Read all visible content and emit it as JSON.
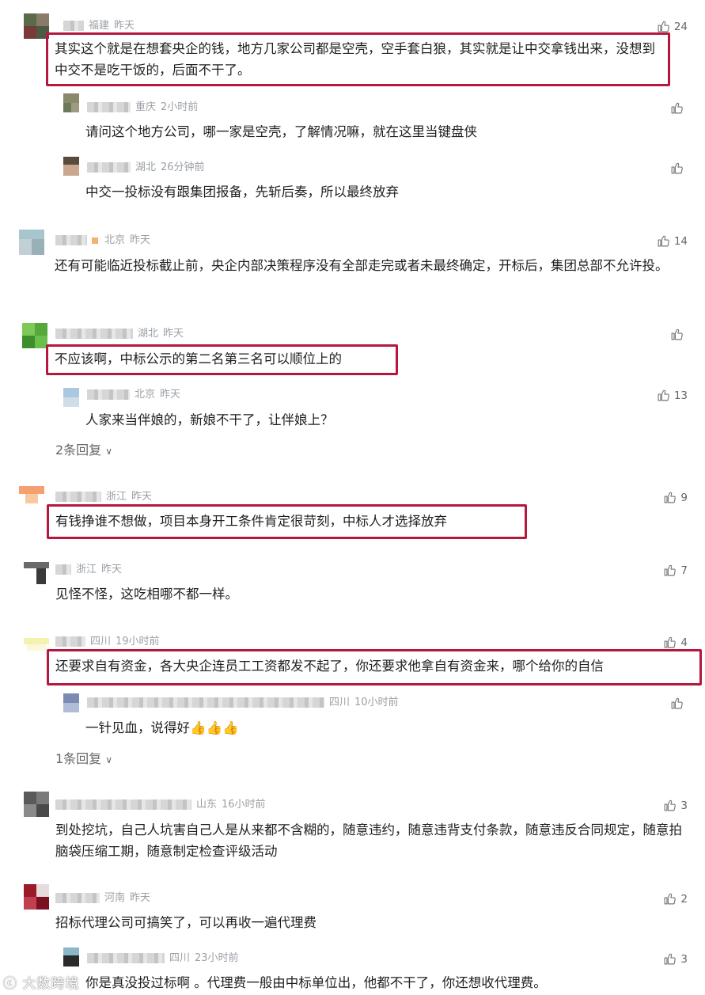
{
  "comments": [
    {
      "location": "福建",
      "time": "昨天",
      "likes": "24",
      "text": "其实这个就是在想套央企的钱，地方几家公司都是空壳，空手套白狼，其实就是让中交拿钱出来，没想到中交不是吃干饭的，后面不干了。"
    },
    {
      "location": "重庆",
      "time": "2小时前",
      "likes": "",
      "text": "请问这个地方公司，哪一家是空壳，了解情况嘛，就在这里当键盘侠"
    },
    {
      "location": "湖北",
      "time": "26分钟前",
      "likes": "",
      "text": "中交一投标没有跟集团报备，先斩后奏，所以最终放弃"
    },
    {
      "location": "北京",
      "time": "昨天",
      "likes": "14",
      "text": "还有可能临近投标截止前，央企内部决策程序没有全部走完或者未最终确定，开标后，集团总部不允许投。"
    },
    {
      "location": "湖北",
      "time": "昨天",
      "likes": "",
      "text": "不应该啊，中标公示的第二名第三名可以顺位上的"
    },
    {
      "location": "北京",
      "time": "昨天",
      "likes": "13",
      "text": "人家来当伴娘的，新娘不干了，让伴娘上？"
    },
    {
      "location": "浙江",
      "time": "昨天",
      "likes": "9",
      "text": "有钱挣谁不想做，项目本身开工条件肯定很苛刻，中标人才选择放弃"
    },
    {
      "location": "浙江",
      "time": "昨天",
      "likes": "7",
      "text": "见怪不怪，这吃相哪不都一样。"
    },
    {
      "location": "四川",
      "time": "19小时前",
      "likes": "4",
      "text": "还要求自有资金，各大央企连员工工资都发不起了，你还要求他拿自有资金来，哪个给你的自信"
    },
    {
      "location": "四川",
      "time": "10小时前",
      "likes": "",
      "text": "一针见血，说得好👍👍👍"
    },
    {
      "location": "山东",
      "time": "16小时前",
      "likes": "3",
      "text": "到处挖坑，自己人坑害自己人是从来都不含糊的，随意违约，随意违背支付条款，随意违反合同规定，随意拍脑袋压缩工期，随意制定检查评级活动"
    },
    {
      "location": "河南",
      "time": "昨天",
      "likes": "2",
      "text": "招标代理公司可搞笑了，可以再收一遍代理费"
    },
    {
      "location": "四川",
      "time": "23小时前",
      "likes": "3",
      "text": "你是真没投过标啊 。代理费一般由中标单位出，他都不干了，你还想收代理费。"
    }
  ],
  "reply_toggles": [
    "2条回复",
    "1条回复"
  ],
  "watermark": "大数跨境",
  "colors": {
    "highlight": "#b5173d",
    "meta": "#9aa0a6",
    "text": "#1f1f1f"
  }
}
